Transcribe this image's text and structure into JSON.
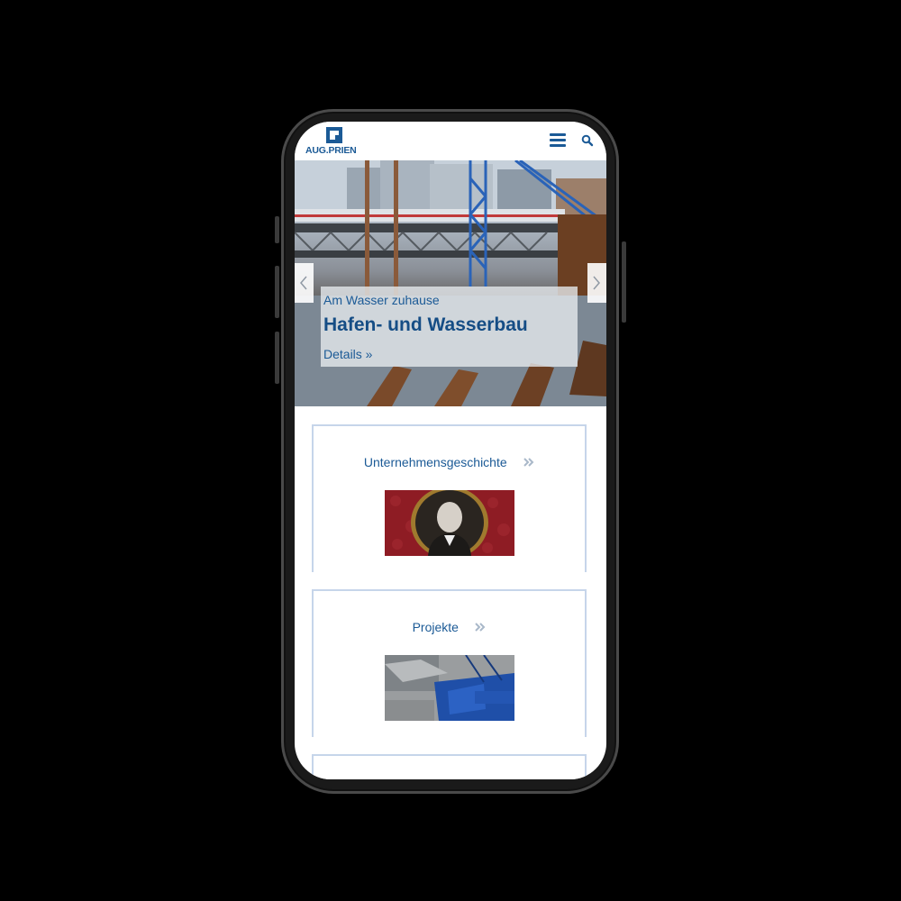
{
  "app": {
    "logo_text": "AUG.PRIEN"
  },
  "header": {
    "menu_icon": "hamburger-menu-icon",
    "search_icon": "search-icon"
  },
  "hero": {
    "kicker": "Am Wasser zuhause",
    "title": "Hafen- und Wasserbau",
    "link": "Details »",
    "prev_icon": "chevron-left-icon",
    "next_icon": "chevron-right-icon"
  },
  "cards": [
    {
      "title": "Unternehmensgeschichte",
      "chevron_icon": "double-chevron-right-icon",
      "image": "portrait-photo"
    },
    {
      "title": "Projekte",
      "chevron_icon": "double-chevron-right-icon",
      "image": "construction-crane-photo"
    }
  ],
  "colors": {
    "brand": "#1b5a96",
    "card_border": "#c6d5ea",
    "chevron": "#a9b8c9"
  }
}
